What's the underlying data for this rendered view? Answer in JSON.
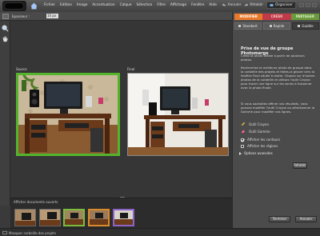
{
  "menubar": {
    "items": [
      "Fichier",
      "Edition",
      "Image",
      "Accentuation",
      "Calque",
      "Sélection",
      "Filtre",
      "Affichage",
      "Fenêtre",
      "Aide"
    ]
  },
  "topright": {
    "undo": "Annuler",
    "redo": "Rétablir",
    "organizer": "Organiser"
  },
  "options": {
    "label": "Epaisseur :",
    "value": "10 px"
  },
  "canvas": {
    "source_label": "Source",
    "final_label": "Final"
  },
  "bin": {
    "label": "Afficher documents ouverts"
  },
  "status": {
    "text": "Masquer corbeille des projets"
  },
  "panel": {
    "tabs": {
      "modifier": "MODIFIER",
      "creer": "CRÉER",
      "partager": "PARTAGER"
    },
    "subtabs": {
      "standard": "Standard",
      "rapide": "Rapide",
      "guidee": "Guidée"
    },
    "title": "Prise de vue de groupe Photomerge",
    "para1": "Créez la photo idéale à partir de plusieurs photos.",
    "para2": "Recherchez la meilleure photo de groupe dans la corbeille des projets et faites-la glisser vers la fenêtre Final située à droite. Cliquez sur d'autres photos de la corbeille et utilisez l'outil Crayon pour tracer une ligne sur les zones à fusionner avec la photo finale.",
    "para3": "Si vous souhaitez affiner vos résultats, vous pouvez modifier l'outil Crayon ou sélectionner la Gomme pour modifier vos lignes.",
    "pencil_tool": "Outil Crayon",
    "eraser_tool": "Outil Gomme",
    "show_strokes": "Afficher les contours",
    "show_regions": "Afficher les régions",
    "advanced": "Options avancées",
    "reset": "Rétablir",
    "finish": "Terminer",
    "cancel": "Annuler"
  },
  "colors": {
    "modifier_tab": "#e8792b",
    "creer_tab": "#c03a4a",
    "partager_tab": "#6a9a3c",
    "source_border": "#54b52c"
  }
}
